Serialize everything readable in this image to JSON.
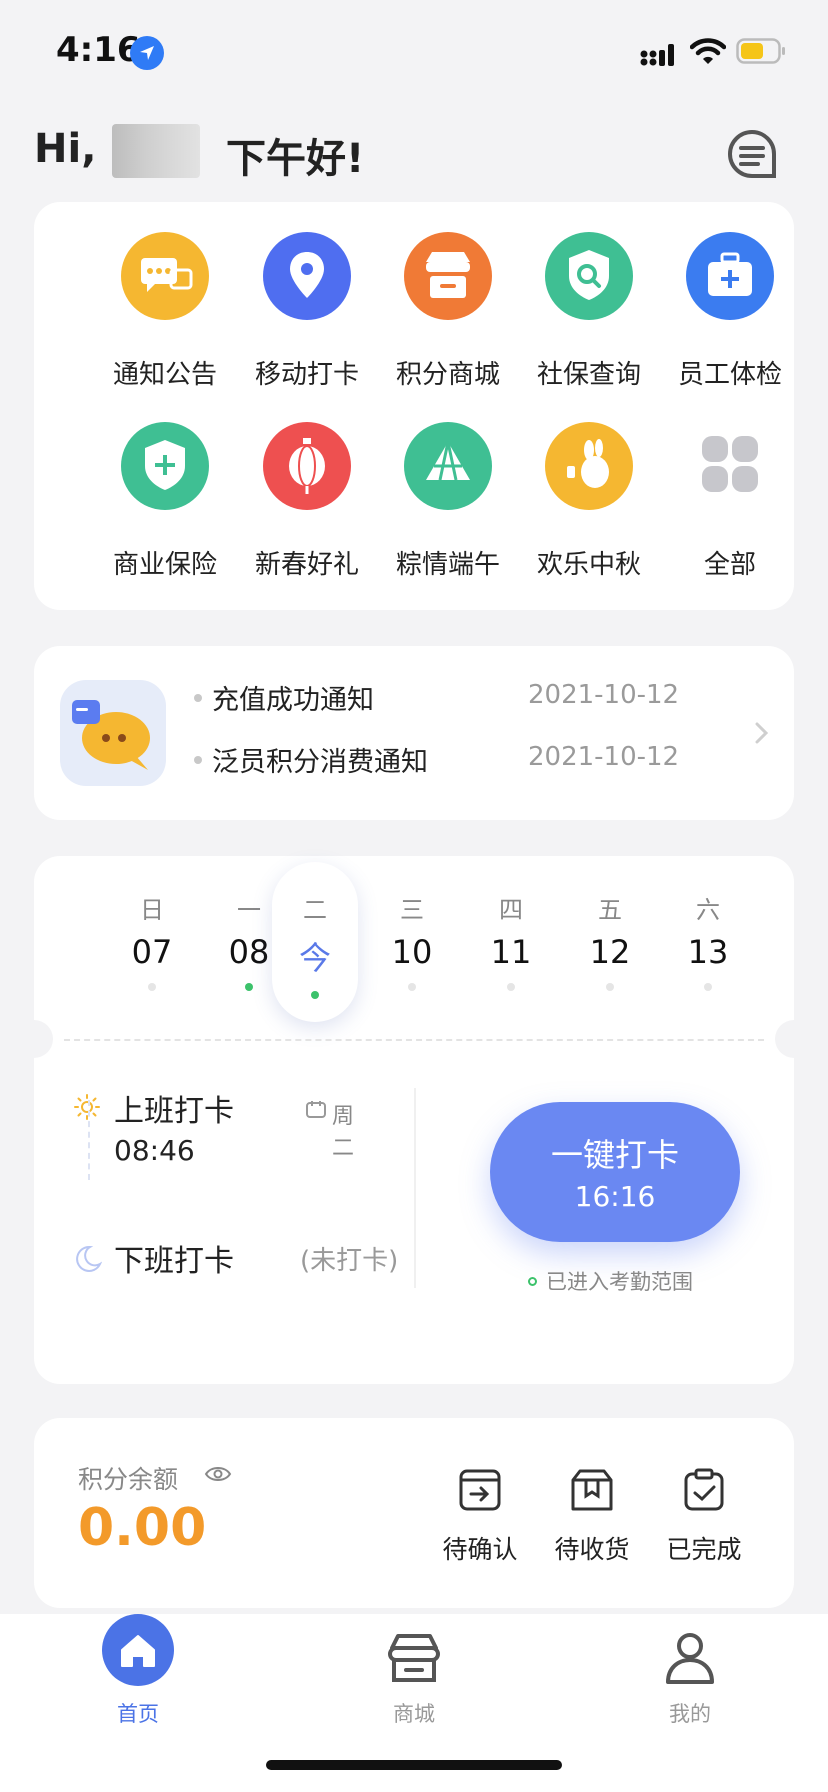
{
  "status": {
    "time": "4:16"
  },
  "greeting": {
    "hi": "Hi,",
    "afternoon": "下午好!"
  },
  "services": [
    {
      "label": "通知公告",
      "icon": "chat-bubbles-icon",
      "color": "#f5b731"
    },
    {
      "label": "移动打卡",
      "icon": "location-pin-icon",
      "color": "#4f6ef0"
    },
    {
      "label": "积分商城",
      "icon": "store-icon",
      "color": "#f07a36"
    },
    {
      "label": "社保查询",
      "icon": "shield-search-icon",
      "color": "#3fbf93"
    },
    {
      "label": "员工体检",
      "icon": "medical-kit-icon",
      "color": "#3b7cf0"
    },
    {
      "label": "商业保险",
      "icon": "shield-plus-icon",
      "color": "#3fbf93"
    },
    {
      "label": "新春好礼",
      "icon": "lantern-icon",
      "color": "#ee5050"
    },
    {
      "label": "粽情端午",
      "icon": "zongzi-icon",
      "color": "#3fbf93"
    },
    {
      "label": "欢乐中秋",
      "icon": "rabbit-icon",
      "color": "#f5b731"
    },
    {
      "label": "全部",
      "icon": "grid-icon",
      "color": "#c7c7cc"
    }
  ],
  "notices": [
    {
      "title": "充值成功通知",
      "date": "2021-10-12"
    },
    {
      "title": "泛员积分消费通知",
      "date": "2021-10-12"
    }
  ],
  "week": [
    {
      "name": "日",
      "num": "07",
      "dot": "none"
    },
    {
      "name": "一",
      "num": "08",
      "dot": "green"
    },
    {
      "name": "二",
      "num": "今",
      "dot": "green",
      "active": true
    },
    {
      "name": "三",
      "num": "10",
      "dot": "none"
    },
    {
      "name": "四",
      "num": "11",
      "dot": "none"
    },
    {
      "name": "五",
      "num": "12",
      "dot": "none"
    },
    {
      "name": "六",
      "num": "13",
      "dot": "none"
    }
  ],
  "attendance": {
    "clock_in_label": "上班打卡",
    "clock_in_time": "08:46",
    "weekday": "周二",
    "clock_out_label": "下班打卡",
    "clock_out_status": "(未打卡)",
    "punch_label": "一键打卡",
    "punch_time": "16:16",
    "range_text": "已进入考勤范围"
  },
  "points": {
    "label": "积分余额",
    "value": "0.00",
    "orders": [
      {
        "label": "待确认",
        "icon": "pending-confirm-icon"
      },
      {
        "label": "待收货",
        "icon": "pending-receive-icon"
      },
      {
        "label": "已完成",
        "icon": "completed-icon"
      }
    ]
  },
  "tabs": [
    {
      "label": "首页",
      "icon": "home-icon",
      "active": true
    },
    {
      "label": "商城",
      "icon": "store-icon"
    },
    {
      "label": "我的",
      "icon": "user-icon"
    }
  ],
  "colors": {
    "accent": "#4b73e6",
    "punch": "#6a88f2",
    "points": "#f39a2a",
    "green": "#3cc26b"
  }
}
